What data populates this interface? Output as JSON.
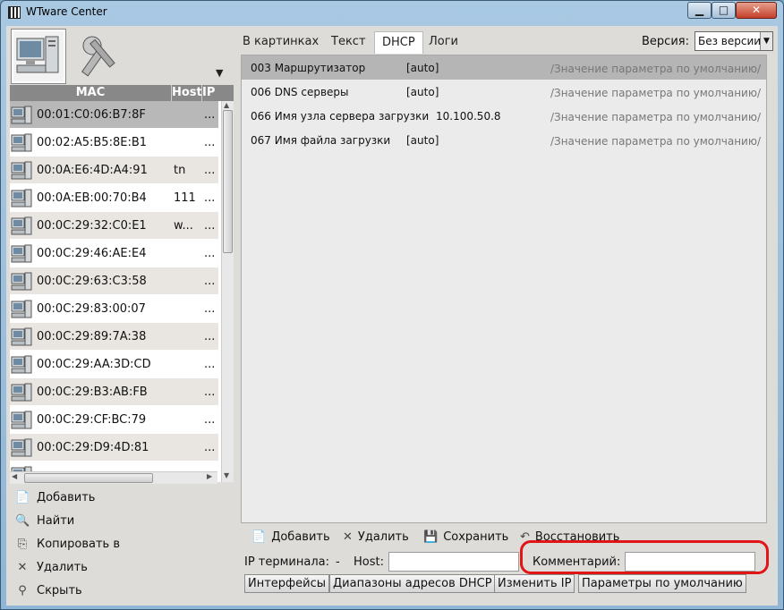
{
  "window": {
    "title": "WTware Center",
    "min_glyph": "▁",
    "max_glyph": "□",
    "close_glyph": "✕"
  },
  "left": {
    "big_icons": [
      "computer-icon",
      "tools-icon"
    ],
    "dropdown_glyph": "▼",
    "columns": {
      "mac": "MAC",
      "host": "Host",
      "ip": "IP"
    },
    "rows": [
      {
        "mac": "00:01:C0:06:B7:8F",
        "host": "",
        "ip": "..."
      },
      {
        "mac": "00:02:A5:B5:8E:B1",
        "host": "",
        "ip": "..."
      },
      {
        "mac": "00:0A:E6:4D:A4:91",
        "host": "tn",
        "ip": "..."
      },
      {
        "mac": "00:0A:EB:00:70:B4",
        "host": "111",
        "ip": "..."
      },
      {
        "mac": "00:0C:29:32:C0:E1",
        "host": "w...",
        "ip": "..."
      },
      {
        "mac": "00:0C:29:46:AE:E4",
        "host": "",
        "ip": "..."
      },
      {
        "mac": "00:0C:29:63:C3:58",
        "host": "",
        "ip": "..."
      },
      {
        "mac": "00:0C:29:83:00:07",
        "host": "",
        "ip": "..."
      },
      {
        "mac": "00:0C:29:89:7A:38",
        "host": "",
        "ip": "..."
      },
      {
        "mac": "00:0C:29:AA:3D:CD",
        "host": "",
        "ip": "..."
      },
      {
        "mac": "00:0C:29:B3:AB:FB",
        "host": "",
        "ip": "..."
      },
      {
        "mac": "00:0C:29:CF:BC:79",
        "host": "",
        "ip": "..."
      },
      {
        "mac": "00:0C:29:D9:4D:81",
        "host": "",
        "ip": "..."
      },
      {
        "mac": "",
        "host": "",
        "ip": ""
      }
    ],
    "actions": [
      {
        "icon": "📄",
        "label": "Добавить"
      },
      {
        "icon": "🔍",
        "label": "Найти"
      },
      {
        "icon": "⎘",
        "label": "Копировать в"
      },
      {
        "icon": "✕",
        "label": "Удалить"
      },
      {
        "icon": "⚲",
        "label": "Скрыть"
      }
    ]
  },
  "tabs": [
    "В картинках",
    "Текст",
    "DHCP",
    "Логи"
  ],
  "version": {
    "label": "Версия:",
    "value": "Без версии",
    "arrow": "▼"
  },
  "params": [
    {
      "name": "003 Маршрутизатор",
      "value": "[auto]",
      "default": "/Значение параметра по умолчанию/"
    },
    {
      "name": "006 DNS серверы",
      "value": "[auto]",
      "default": "/Значение параметра по умолчанию/"
    },
    {
      "name": "066 Имя узла сервера загрузки",
      "value": "10.100.50.8",
      "default": "/Значение параметра по умолчанию/"
    },
    {
      "name": "067 Имя файла загрузки",
      "value": "[auto]",
      "default": "/Значение параметра по умолчанию/"
    }
  ],
  "param_tools": {
    "add": "Добавить",
    "delete": "Удалить",
    "save": "Сохранить",
    "restore": "Восстановить",
    "add_icon": "📄",
    "delete_icon": "✕",
    "save_icon": "💾",
    "restore_icon": "↶"
  },
  "ipline": {
    "ip_label": "IP терминала:",
    "ip_value": "-",
    "host_label": "Host:",
    "comment_label": "Комментарий:"
  },
  "buttons": [
    "Интерфейсы",
    "Диапазоны адресов DHCP",
    "Изменить IP",
    "Параметры по умолчанию"
  ]
}
